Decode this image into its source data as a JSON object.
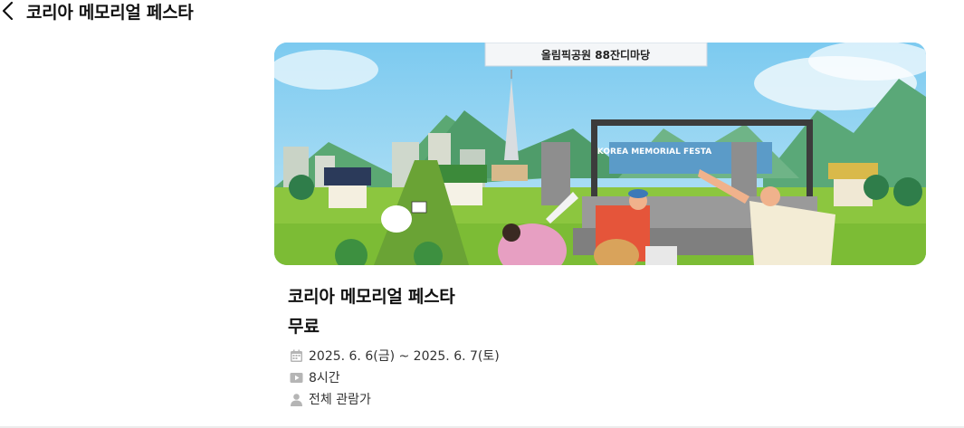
{
  "header": {
    "title": "코리아 메모리얼 페스타"
  },
  "banner": {
    "venue_text": "올림픽공원 88잔디마당",
    "stage_text": "KOREA MEMORIAL FESTA"
  },
  "event": {
    "title": "코리아 메모리얼 페스타",
    "price": "무료",
    "date": "2025. 6. 6(금) ~ 2025. 6. 7(토)",
    "duration": "8시간",
    "age": "전체 관람가"
  },
  "icons": {
    "back": "chevron-left-icon",
    "date": "calendar-icon",
    "duration": "play-icon",
    "age": "person-icon"
  },
  "colors": {
    "sky": "#8fd0ee",
    "grass": "#8cc63f",
    "icon_gray": "#b5b5b5"
  }
}
